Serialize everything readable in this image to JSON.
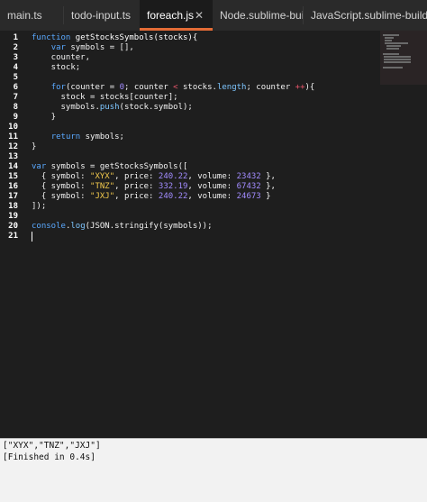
{
  "tabs": [
    {
      "label": "main.ts",
      "active": false
    },
    {
      "label": "todo-input.ts",
      "active": false
    },
    {
      "label": "foreach.js",
      "active": true
    },
    {
      "label": "Node.sublime-build",
      "active": false
    },
    {
      "label": "JavaScript.sublime-build",
      "active": false
    }
  ],
  "tab_close_icon": "close-icon",
  "editor": {
    "line_numbers": [
      "1",
      "2",
      "3",
      "4",
      "5",
      "6",
      "7",
      "8",
      "9",
      "10",
      "11",
      "12",
      "13",
      "14",
      "15",
      "16",
      "17",
      "18",
      "19",
      "20",
      "21"
    ],
    "code": {
      "l1_kw": "function ",
      "l1_fn": "getStocksSymbols(stocks){",
      "l2_a": "    ",
      "l2_kw": "var",
      "l2_b": " symbols = [],",
      "l3": "    counter,",
      "l4": "    stock;",
      "l6_a": "    ",
      "l6_kw": "for",
      "l6_b": "(counter = ",
      "l6_num": "0",
      "l6_c": "; counter ",
      "l6_op1": "<",
      "l6_d": " stocks.",
      "l6_prop": "length",
      "l6_e": "; counter ",
      "l6_op2": "++",
      "l6_f": "){",
      "l7": "      stock = stocks[counter];",
      "l8_a": "      symbols.",
      "l8_prop": "push",
      "l8_b": "(stock.symbol);",
      "l9": "    }",
      "l11_a": "    ",
      "l11_kw": "return",
      "l11_b": " symbols;",
      "l12": "}",
      "l14_kw": "var",
      "l14_b": " symbols = getStocksSymbols([",
      "l15_a": "  { symbol: ",
      "l15_s": "\"XYX\"",
      "l15_b": ", price: ",
      "l15_n1": "240.22",
      "l15_c": ", volume: ",
      "l15_n2": "23432",
      "l15_d": " },",
      "l16_a": "  { symbol: ",
      "l16_s": "\"TNZ\"",
      "l16_b": ", price: ",
      "l16_n1": "332.19",
      "l16_c": ", volume: ",
      "l16_n2": "67432",
      "l16_d": " },",
      "l17_a": "  { symbol: ",
      "l17_s": "\"JXJ\"",
      "l17_b": ", price: ",
      "l17_n1": "240.22",
      "l17_c": ", volume: ",
      "l17_n2": "24673",
      "l17_d": " }",
      "l18": "]);",
      "l20_kw": "console",
      "l20_a": ".",
      "l20_prop": "log",
      "l20_b": "(JSON.stringify(symbols));"
    }
  },
  "output": {
    "lines": [
      "[\"XYX\",\"TNZ\",\"JXJ\"]",
      "[Finished in 0.4s]"
    ]
  },
  "colors": {
    "accent": "#e36b36",
    "keyword": "#5aa9ff",
    "number": "#a28cff",
    "string": "#f2c94c",
    "operator": "#e8556b"
  }
}
